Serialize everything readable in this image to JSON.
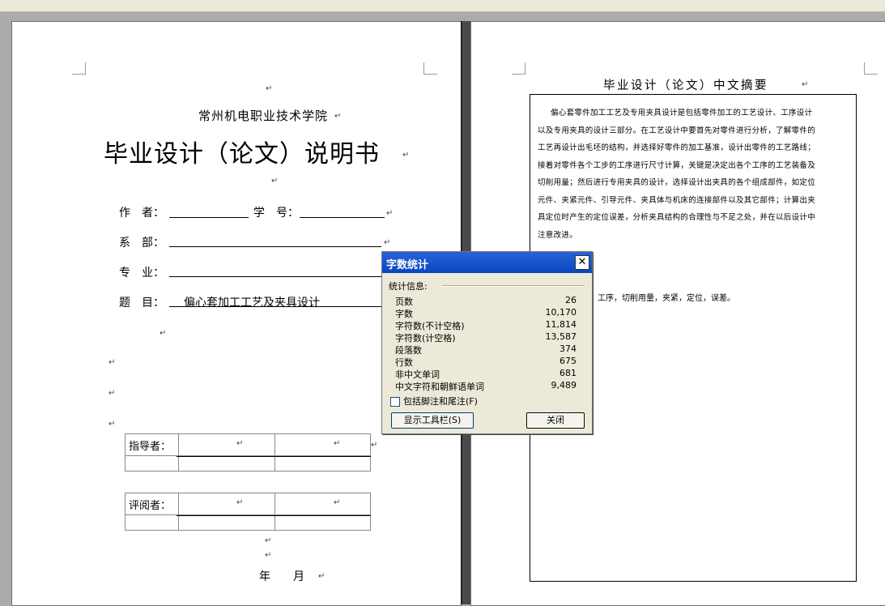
{
  "left_page": {
    "school": "常州机电职业技术学院",
    "title": "毕业设计（论文）说明书",
    "fields": {
      "author_label": "作　者：",
      "student_id_label": "学　号：",
      "department_label": "系　部：",
      "major_label": "专　业：",
      "topic_label": "题　目：",
      "topic_value": "偏心套加工工艺及夹具设计"
    },
    "advisor_label": "指导者：",
    "reviewer_label": "评阅者：",
    "date_label": "年　　月"
  },
  "right_page": {
    "heading": "毕业设计（论文）中文摘要",
    "abstract_lines": [
      "偏心套零件加工工艺及专用夹具设计是包括零件加工的工艺设计、工序设计",
      "以及专用夹具的设计三部分。在工艺设计中要首先对零件进行分析，了解零件的",
      "工艺再设计出毛坯的结构，并选择好零件的加工基准，设计出零件的工艺路线；",
      "接着对零件各个工步的工序进行尺寸计算，关键是决定出各个工序的工艺装备及",
      "切削用量；然后进行专用夹具的设计，选择设计出夹具的各个组成部件，如定位",
      "元件、夹紧元件、引导元件、夹具体与机床的连接部件以及其它部件；计算出夹",
      "具定位时产生的定位误差，分析夹具结构的合理性与不足之处，并在以后设计中",
      "注意改进。"
    ],
    "keywords_fragment": "工序，切削用量，夹紧，定位，误差。"
  },
  "dialog": {
    "title": "字数统计",
    "close_glyph": "✕",
    "section_label": "统计信息:",
    "stats": [
      {
        "key": "页数",
        "value": "26"
      },
      {
        "key": "字数",
        "value": "10,170"
      },
      {
        "key": "字符数(不计空格)",
        "value": "11,814"
      },
      {
        "key": "字符数(计空格)",
        "value": "13,587"
      },
      {
        "key": "段落数",
        "value": "374"
      },
      {
        "key": "行数",
        "value": "675"
      },
      {
        "key": "非中文单词",
        "value": "681"
      },
      {
        "key": "中文字符和朝鲜语单词",
        "value": "9,489"
      }
    ],
    "checkbox_label": "包括脚注和尾注(F)",
    "checkbox_checked": false,
    "toolbar_button": "显示工具栏(S)",
    "close_button": "关闭"
  },
  "marks": {
    "para": "↵"
  }
}
